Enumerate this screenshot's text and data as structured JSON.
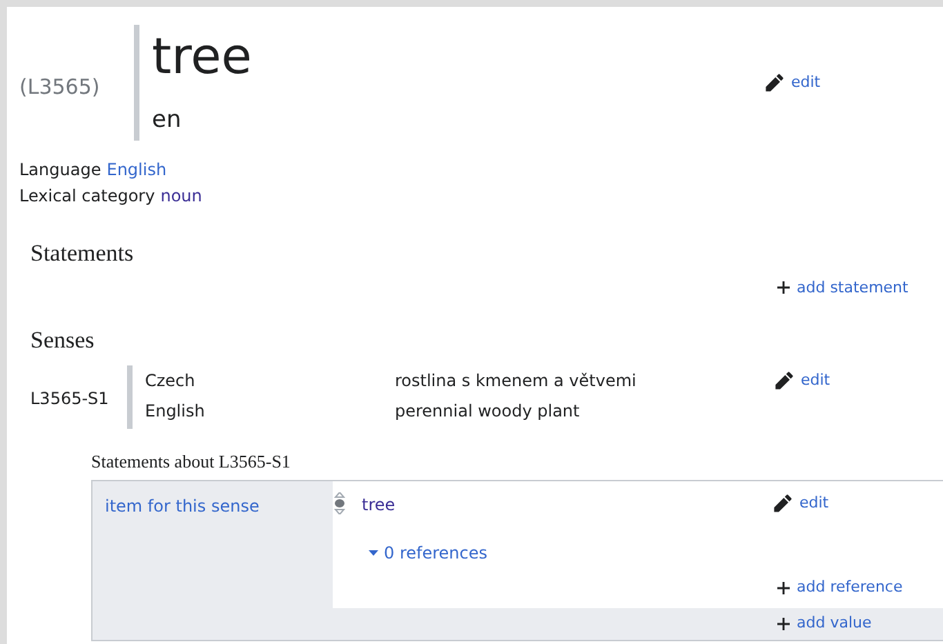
{
  "lexeme": {
    "id": "(L3565)",
    "lemma": "tree",
    "lemma_language": "en",
    "edit": "edit"
  },
  "properties": [
    {
      "label": "Language",
      "value": "English",
      "visited": false
    },
    {
      "label": "Lexical category",
      "value": "noun",
      "visited": true
    }
  ],
  "statements": {
    "heading": "Statements",
    "add": "add statement"
  },
  "senses": {
    "heading": "Senses",
    "items": [
      {
        "id": "L3565-S1",
        "edit": "edit",
        "glosses": [
          {
            "language": "Czech",
            "gloss": "rostlina s kmenem a větvemi"
          },
          {
            "language": "English",
            "gloss": "perennial woody plant"
          }
        ],
        "statements_heading": "Statements about L3565-S1",
        "statement_groups": [
          {
            "property": "item for this sense",
            "add_value": "add value",
            "values": [
              {
                "value": "tree",
                "edit": "edit",
                "references": "0 references",
                "add_reference": "add reference"
              }
            ]
          }
        ]
      }
    ]
  }
}
